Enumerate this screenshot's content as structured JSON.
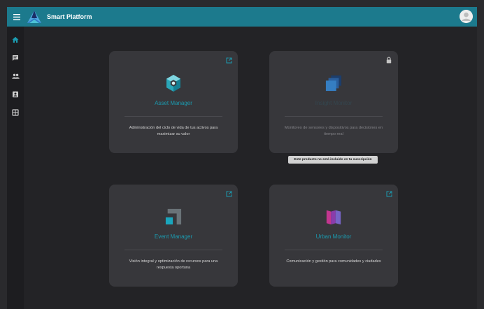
{
  "app": {
    "title": "Smart Platform"
  },
  "colors": {
    "topbar": "#1c7a8d",
    "accent": "#1b9bb0",
    "card_bg": "#37373b",
    "content_bg": "#232326",
    "sidebar_bg": "#1d1d20"
  },
  "sidebar": {
    "items": [
      {
        "icon": "home-icon",
        "active": true
      },
      {
        "icon": "chat-icon",
        "active": false
      },
      {
        "icon": "people-icon",
        "active": false
      },
      {
        "icon": "contact-card-icon",
        "active": false
      },
      {
        "icon": "grid-icon",
        "active": false
      }
    ]
  },
  "products": [
    {
      "title": "Asset Manager",
      "description": "Administración del ciclo de vida de tus activos para maximizar su valor",
      "corner_icon": "open-external-icon",
      "product_icon": "cube-icon",
      "enabled": true
    },
    {
      "title": "Insight Monitor",
      "description": "Monitoreo de sensores y dispositivos para decisiones en tiempo real",
      "corner_icon": "lock-icon",
      "product_icon": "stacked-squares-icon",
      "enabled": false
    },
    {
      "title": "Event Manager",
      "description": "Visión integral y optimización de recursos para una respuesta oportuna",
      "corner_icon": "open-external-icon",
      "product_icon": "corner-squares-icon",
      "enabled": true
    },
    {
      "title": "Urban Monitor",
      "description": "Comunicación y gestión para comunidades y ciudades",
      "corner_icon": "open-external-icon",
      "product_icon": "book-icon",
      "enabled": true
    }
  ],
  "tooltip": {
    "text": "Este producto no está incluido en tu suscripción"
  }
}
